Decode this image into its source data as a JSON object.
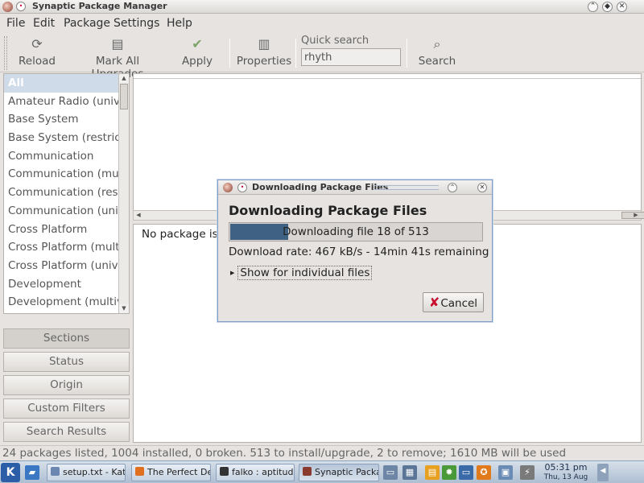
{
  "window": {
    "title": "Synaptic Package Manager"
  },
  "menu": [
    "File",
    "Edit",
    "Package",
    "Settings",
    "Help"
  ],
  "toolbar": {
    "reload": "Reload",
    "mark_all": "Mark All Upgrades",
    "apply": "Apply",
    "properties": "Properties",
    "quick_search_label": "Quick search",
    "quick_search_value": "rhyth",
    "search": "Search"
  },
  "sections": {
    "items": [
      "All",
      "Amateur Radio (universe)",
      "Base System",
      "Base System (restricted)",
      "Communication",
      "Communication (multiverse)",
      "Communication (restricted)",
      "Communication (universe)",
      "Cross Platform",
      "Cross Platform (multiverse)",
      "Cross Platform (universe)",
      "Development",
      "Development (multiverse)"
    ],
    "selected_index": 0
  },
  "filter_buttons": [
    "Sections",
    "Status",
    "Origin",
    "Custom Filters",
    "Search Results"
  ],
  "description_text": "No package is selected.",
  "statusbar": "24 packages listed, 1004 installed, 0 broken. 513 to install/upgrade, 2 to remove; 1610 MB will be used",
  "dialog": {
    "window_title": "Downloading Package Files",
    "heading": "Downloading Package Files",
    "progress_text": "Downloading file 18 of 513",
    "progress_fraction": 0.23,
    "rate": "Download rate: 467 kB/s - 14min 41s remaining",
    "expander": "Show for individual files",
    "cancel": "Cancel"
  },
  "taskbar": {
    "tasks": [
      {
        "label": "setup.txt - Kate",
        "color": "#6b86b0"
      },
      {
        "label": "The Perfect Desktop",
        "color": "#e07020"
      },
      {
        "label": "falko : aptitude",
        "color": "#333333"
      },
      {
        "label": "Synaptic Package Manager",
        "color": "#8b3b2e"
      }
    ],
    "clock_time": "05:31 pm",
    "clock_date": "Thu, 13 Aug"
  }
}
